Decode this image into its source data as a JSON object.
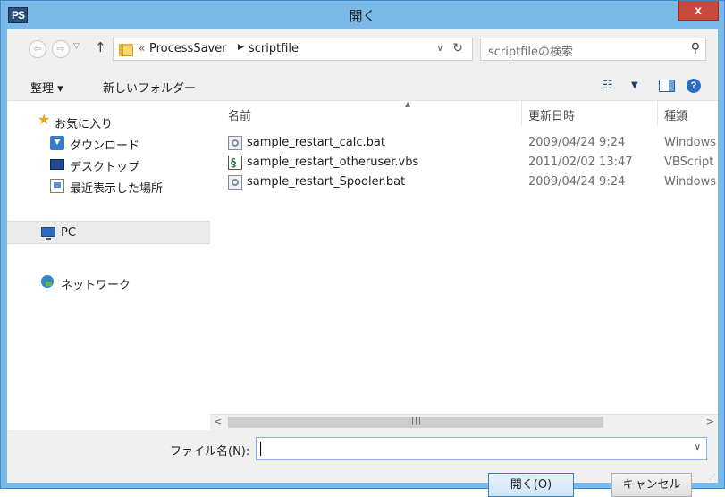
{
  "window": {
    "title": "開く",
    "app_icon_text": "PS",
    "close_label": "x"
  },
  "address_bar": {
    "overflow": "«",
    "crumbs": [
      "ProcessSaver",
      "scriptfile"
    ],
    "search_placeholder": "scriptfileの検索"
  },
  "toolbar": {
    "organize_label": "整理 ▾",
    "new_folder_label": "新しいフォルダー"
  },
  "nav_pane": {
    "items": [
      {
        "label": "お気に入り",
        "icon": "star-icon"
      },
      {
        "label": "ダウンロード",
        "icon": "download-icon"
      },
      {
        "label": "デスクトップ",
        "icon": "desktop-icon"
      },
      {
        "label": "最近表示した場所",
        "icon": "recent-places-icon"
      },
      {
        "label": "PC",
        "icon": "pc-icon"
      },
      {
        "label": "ネットワーク",
        "icon": "network-icon"
      }
    ]
  },
  "file_list": {
    "columns": [
      "名前",
      "更新日時",
      "種類"
    ],
    "rows": [
      {
        "name": "sample_restart_calc.bat",
        "date": "2009/04/24 9:24",
        "type": "Windows",
        "icon": "batch-file-icon"
      },
      {
        "name": "sample_restart_otheruser.vbs",
        "date": "2011/02/02 13:47",
        "type": "VBScript",
        "icon": "vbs-file-icon"
      },
      {
        "name": "sample_restart_Spooler.bat",
        "date": "2009/04/24 9:24",
        "type": "Windows",
        "icon": "batch-file-icon"
      }
    ]
  },
  "footer": {
    "filename_label": "ファイル名(N):",
    "filename_value": "",
    "open_label": "開く(O)",
    "cancel_label": "キャンセル"
  },
  "colors": {
    "titlebar": "#7ab9e8",
    "close_button": "#c74a3d",
    "accent": "#3c7fb1"
  }
}
